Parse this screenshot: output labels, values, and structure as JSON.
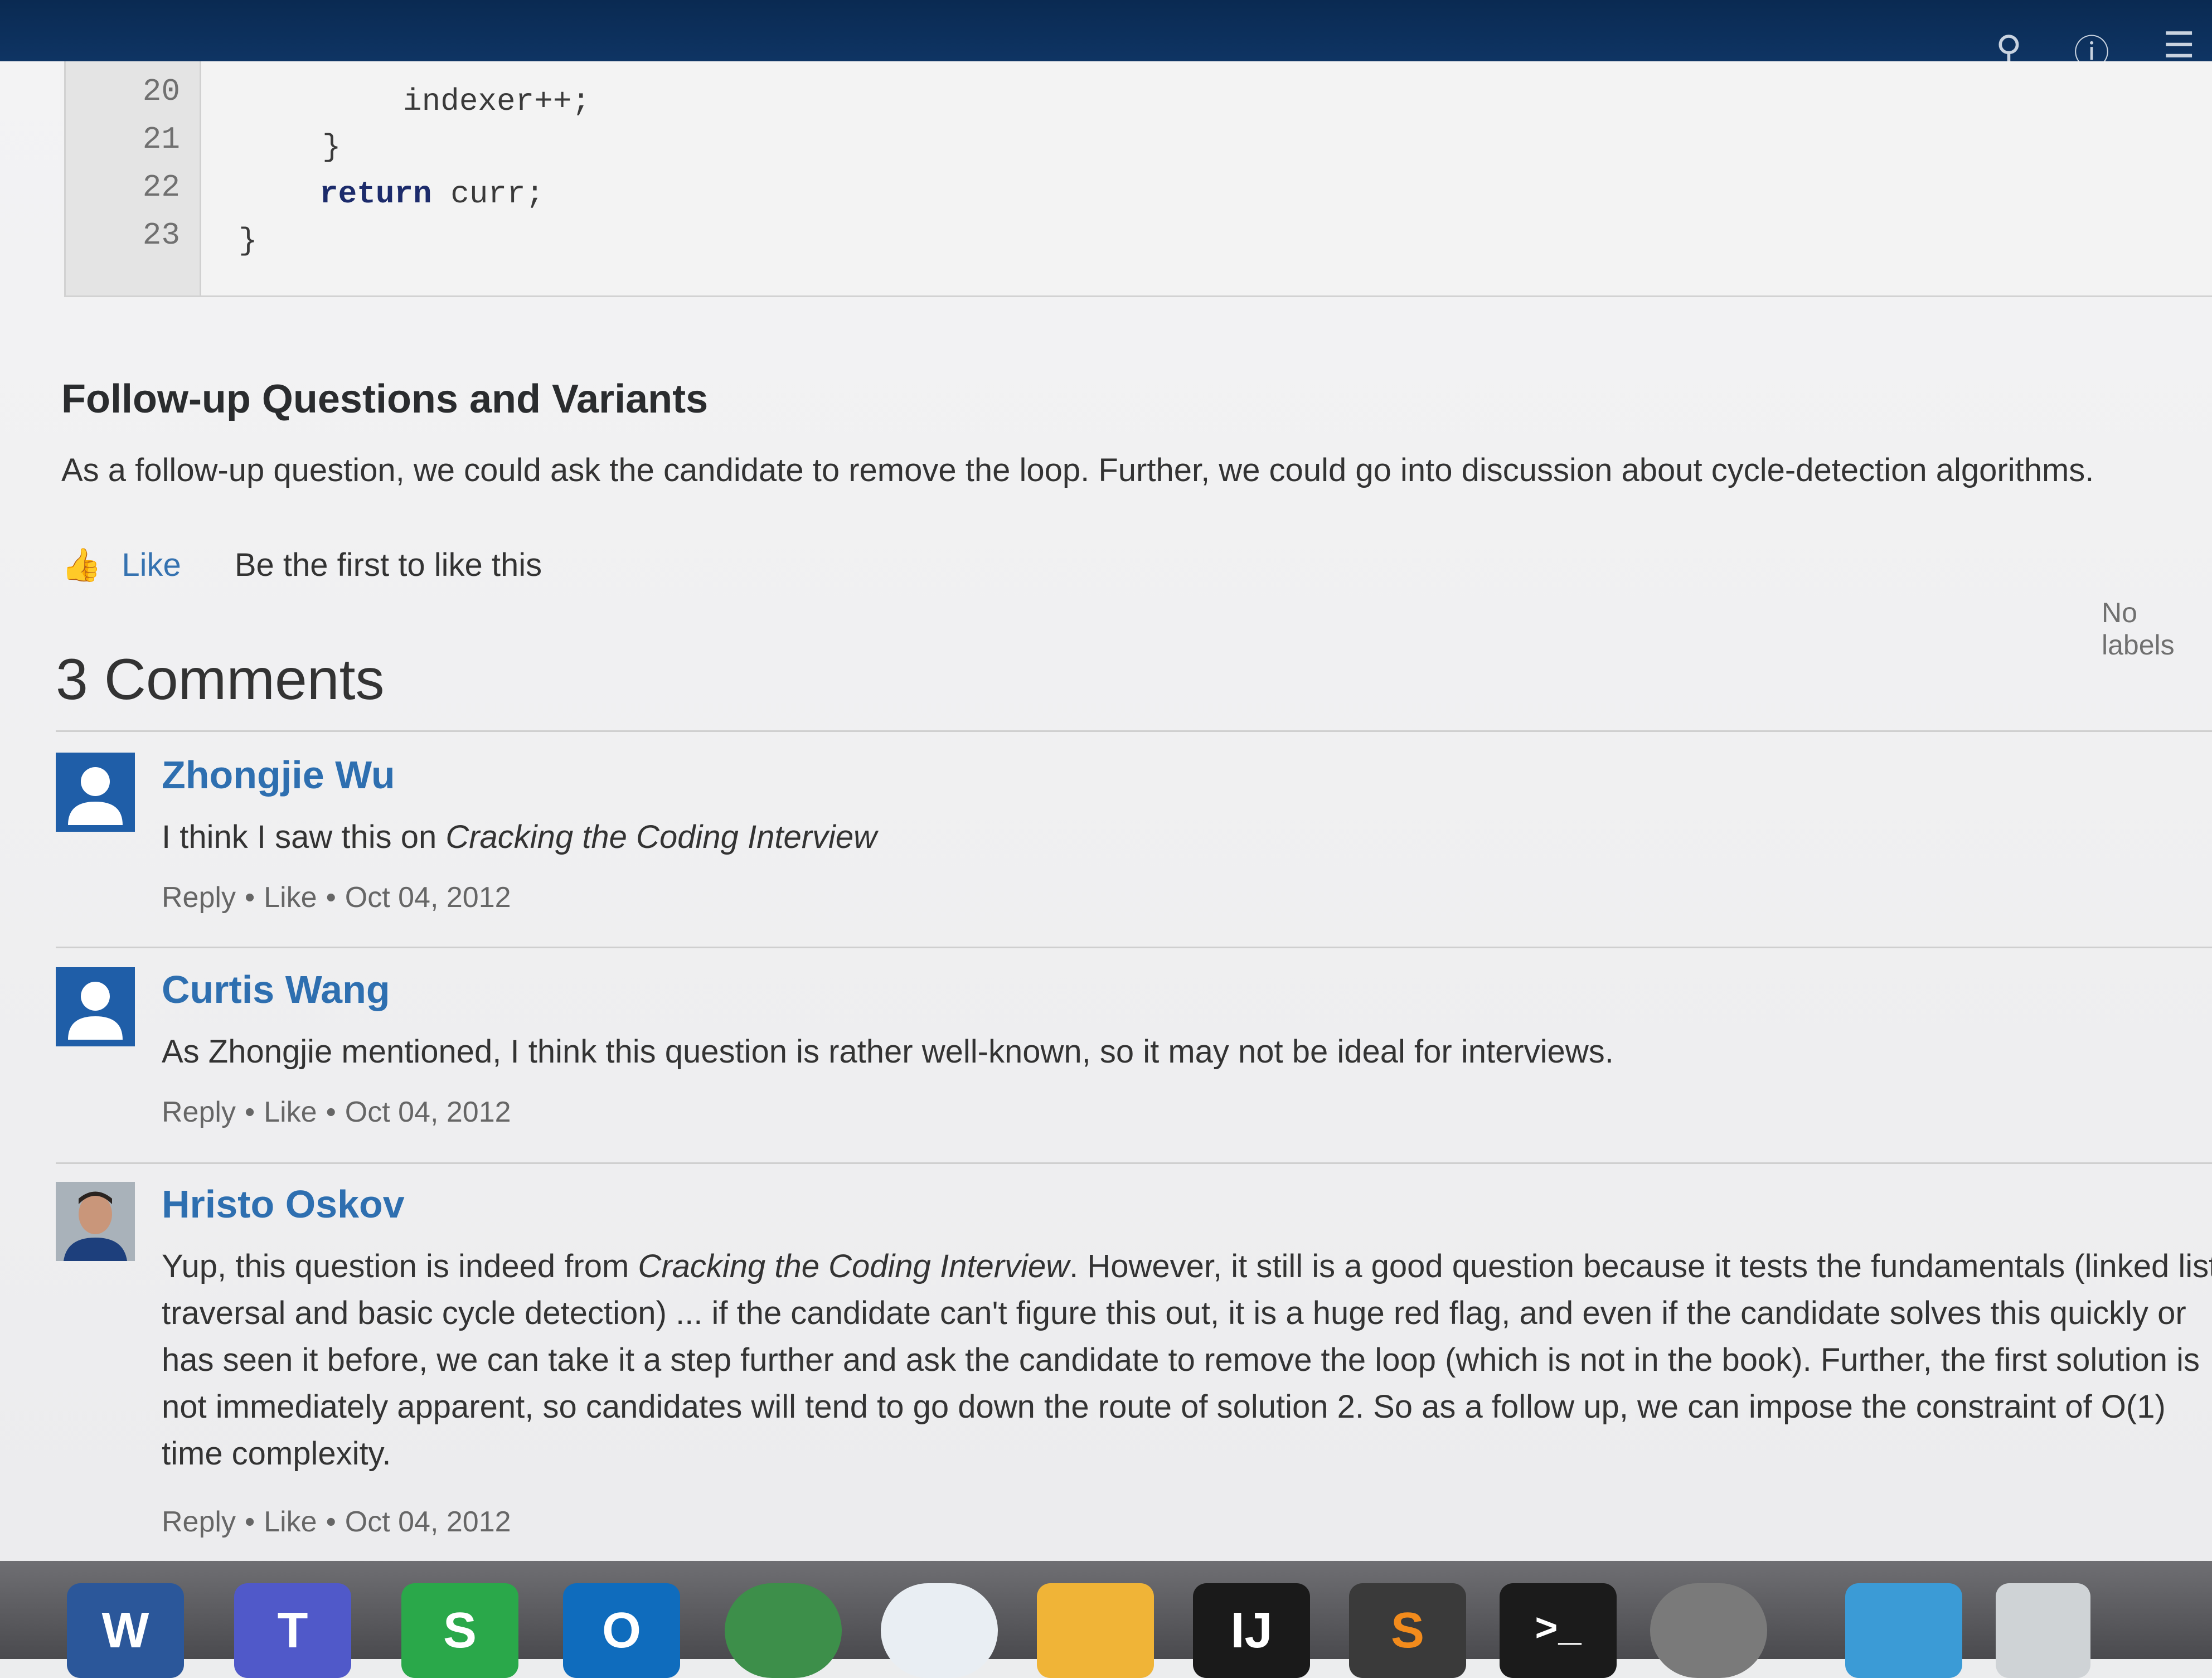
{
  "code": {
    "lines": [
      {
        "num": "20",
        "text": "indexer++;"
      },
      {
        "num": "21",
        "text": "}"
      },
      {
        "num": "22",
        "keyword": "return",
        "text": " curr;"
      },
      {
        "num": "23",
        "text": "}"
      }
    ]
  },
  "section": {
    "heading": "Follow-up Questions and Variants",
    "paragraph": "As a follow-up question, we could ask the candidate to remove the loop. Further, we could go into discussion about cycle-detection algorithms.",
    "like_label": "Like",
    "like_hint": "Be the first to like this",
    "labels_text": "No labels"
  },
  "comments_heading": "3 Comments",
  "comments": [
    {
      "author": "Zhongjie Wu",
      "body_plain": "I think I saw this on ",
      "body_italic": "Cracking the Coding Interview",
      "body_rest": "",
      "reply": "Reply",
      "like": "Like",
      "date": "Oct 04, 2012"
    },
    {
      "author": "Curtis Wang",
      "body_plain": "As Zhongjie mentioned, I think this question is rather well-known, so it may not be ideal for interviews.",
      "body_italic": "",
      "body_rest": "",
      "reply": "Reply",
      "like": "Like",
      "date": "Oct 04, 2012"
    },
    {
      "author": "Hristo Oskov",
      "body_plain": "Yup, this question is indeed from ",
      "body_italic": "Cracking the Coding Interview",
      "body_rest": ". However, it still is a good question because it tests the fundamentals (linked list traversal and basic cycle detection) ... if the candidate can't figure this out, it is a huge red flag, and even if the candidate solves this quickly or has seen it before, we can take it a step further and ask the candidate to remove the loop (which is not in the book). Further, the first solution is not immediately apparent, so candidates will tend to go down the route of solution 2. So as a follow up, we can impose the constraint of O(1) time complexity.",
      "reply": "Reply",
      "like": "Like",
      "date": "Oct 04, 2012"
    }
  ],
  "meta_separator": "•",
  "header_icons": [
    "search-icon",
    "help-icon",
    "user-menu-icon"
  ],
  "dock": {
    "apps": [
      {
        "name": "word-icon",
        "glyph": "W",
        "color": "#2b579a"
      },
      {
        "name": "teams-icon",
        "glyph": "T",
        "color": "#5059c9"
      },
      {
        "name": "skype-icon",
        "glyph": "S",
        "color": "#2aa84a"
      },
      {
        "name": "outlook-icon",
        "glyph": "O",
        "color": "#0f6cbd"
      },
      {
        "name": "safari-icon",
        "glyph": "",
        "color": "#3d8f4a"
      },
      {
        "name": "airdrop-icon",
        "glyph": "",
        "color": "#e9eef3"
      },
      {
        "name": "launcher-icon",
        "glyph": "",
        "color": "#f0b437"
      },
      {
        "name": "intellij-icon",
        "glyph": "IJ",
        "color": "#1a1a1a"
      },
      {
        "name": "sublime-icon",
        "glyph": "S",
        "color": "#3a3a3a"
      },
      {
        "name": "terminal-icon",
        "glyph": ">_",
        "color": "#1b1b1b"
      },
      {
        "name": "system-preferences-icon",
        "glyph": "",
        "color": "#7a7a7a"
      },
      {
        "name": "downloads-folder-icon",
        "glyph": "",
        "color": "#3b9bd6"
      },
      {
        "name": "trash-icon",
        "glyph": "",
        "color": "#cfd3d6"
      }
    ]
  }
}
